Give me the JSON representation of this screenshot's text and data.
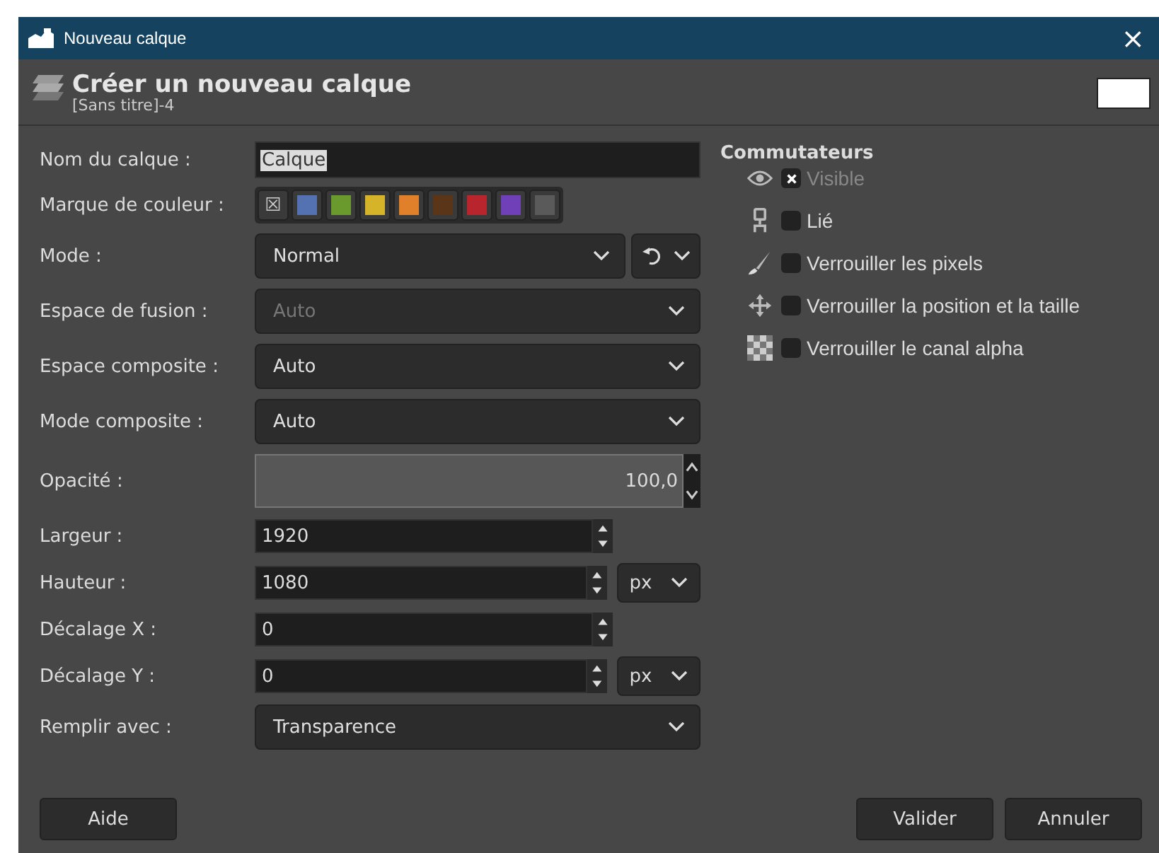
{
  "window": {
    "title": "Nouveau calque",
    "close": "×"
  },
  "header": {
    "title": "Créer un nouveau calque",
    "subtitle": "[Sans titre]-4"
  },
  "fields": [
    {
      "kind": "text",
      "label": "Nom du calque :",
      "value": "Calque"
    },
    {
      "kind": "colors",
      "label": "Marque de couleur :",
      "tags": [
        {
          "kind": "none",
          "glyph": "☒"
        },
        {
          "kind": "color",
          "color": "#5472b2"
        },
        {
          "kind": "color",
          "color": "#6a9a2e"
        },
        {
          "kind": "color",
          "color": "#d6b42a"
        },
        {
          "kind": "color",
          "color": "#e0802a"
        },
        {
          "kind": "color",
          "color": "#5a3518"
        },
        {
          "kind": "color",
          "color": "#b8252c"
        },
        {
          "kind": "color",
          "color": "#7040b8"
        },
        {
          "kind": "color",
          "color": "#5a5a5a"
        }
      ]
    },
    {
      "kind": "combo",
      "label": "Mode :",
      "value": "Normal",
      "disabled": false,
      "extra": true
    },
    {
      "kind": "combo",
      "label": "Espace de fusion :",
      "value": "Auto",
      "disabled": true
    },
    {
      "kind": "combo",
      "label": "Espace composite :",
      "value": "Auto",
      "disabled": false
    },
    {
      "kind": "combo",
      "label": "Mode composite :",
      "value": "Auto",
      "disabled": false
    },
    {
      "kind": "slider",
      "label": "Opacité :",
      "value": "100,0",
      "level": 1.0
    },
    {
      "kind": "spin",
      "label": "Largeur :",
      "value": "1920"
    },
    {
      "kind": "spin",
      "label": "Hauteur :",
      "value": "1080",
      "unit": "px"
    },
    {
      "kind": "spin",
      "label": "Décalage X :",
      "value": "0"
    },
    {
      "kind": "spin",
      "label": "Décalage Y :",
      "value": "0",
      "unit": "px"
    },
    {
      "kind": "combo",
      "label": "Remplir avec :",
      "value": "Transparence",
      "disabled": false
    }
  ],
  "switches": {
    "title": "Commutateurs",
    "items": [
      {
        "kind": "eye",
        "label": "Visible",
        "checked": true,
        "disabled": true
      },
      {
        "kind": "chain",
        "label": "Lié",
        "checked": false,
        "disabled": false
      },
      {
        "kind": "brush",
        "label": "Verrouiller les pixels",
        "checked": false,
        "disabled": false
      },
      {
        "kind": "move",
        "label": "Verrouiller la position et la taille",
        "checked": false,
        "disabled": false
      },
      {
        "kind": "alpha",
        "label": "Verrouiller le canal alpha",
        "checked": false,
        "disabled": false
      }
    ]
  },
  "buttons": {
    "help": "Aide",
    "ok": "Valider",
    "cancel": "Annuler"
  }
}
